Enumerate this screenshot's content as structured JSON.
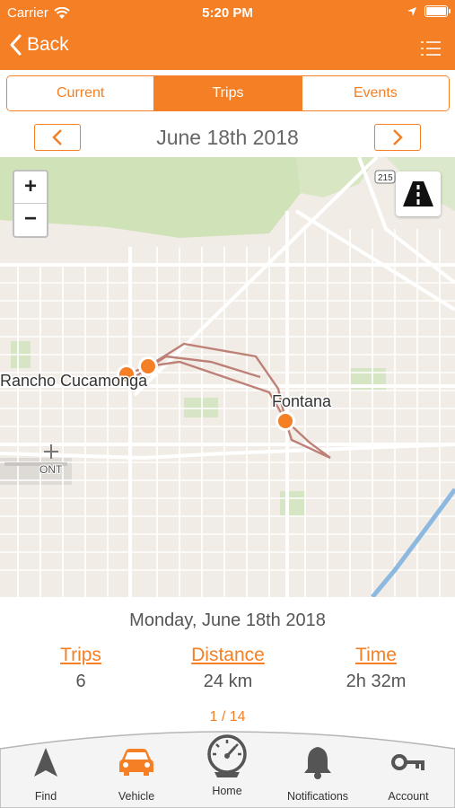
{
  "status_bar": {
    "carrier": "Carrier",
    "time": "5:20 PM"
  },
  "nav": {
    "back_label": "Back"
  },
  "segments": [
    {
      "label": "Current",
      "active": false
    },
    {
      "label": "Trips",
      "active": true
    },
    {
      "label": "Events",
      "active": false
    }
  ],
  "date_title": "June 18th 2018",
  "map": {
    "labels": {
      "rancho": "Rancho Cucamonga",
      "fontana": "Fontana",
      "ont": "ONT",
      "highway": "215"
    }
  },
  "summary": {
    "date": "Monday, June 18th 2018",
    "trips_label": "Trips",
    "trips_value": "6",
    "distance_label": "Distance",
    "distance_value": "24 km",
    "time_label": "Time",
    "time_value": "2h 32m",
    "pager": "1 / 14"
  },
  "tabs": [
    {
      "label": "Find",
      "icon": "navigation-arrow-icon"
    },
    {
      "label": "Vehicle",
      "icon": "car-icon"
    },
    {
      "label": "Home",
      "icon": "speedometer-icon"
    },
    {
      "label": "Notifications",
      "icon": "bell-icon"
    },
    {
      "label": "Account",
      "icon": "key-icon"
    }
  ],
  "colors": {
    "accent": "#f47f25",
    "route": "#b8756a"
  }
}
